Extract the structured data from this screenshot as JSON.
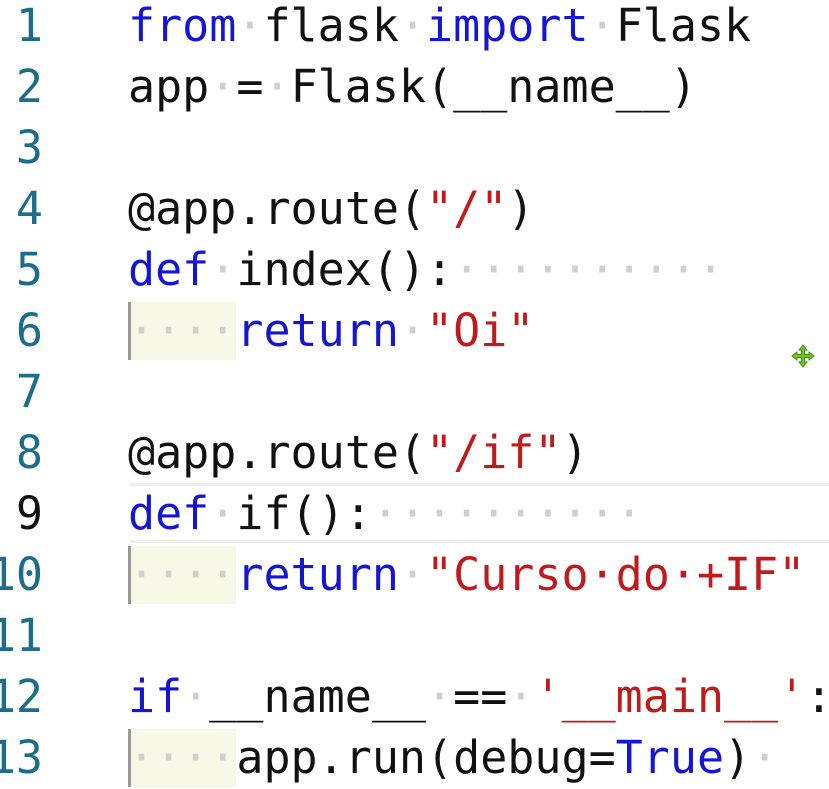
{
  "editor": {
    "language": "python",
    "colors": {
      "keyword": "#1515d8",
      "string": "#c21a1a",
      "line_number": "#1e6c8c",
      "whitespace_marker": "#cfcfcf"
    },
    "lines": [
      {
        "number": "1",
        "segments": [
          {
            "t": "kw",
            "v": "from"
          },
          {
            "t": "ws",
            "v": "·"
          },
          {
            "t": "tx",
            "v": "flask"
          },
          {
            "t": "ws",
            "v": "·"
          },
          {
            "t": "kw",
            "v": "import"
          },
          {
            "t": "ws",
            "v": "·"
          },
          {
            "t": "tx",
            "v": "Flask"
          }
        ]
      },
      {
        "number": "2",
        "segments": [
          {
            "t": "tx",
            "v": "app"
          },
          {
            "t": "ws",
            "v": "·"
          },
          {
            "t": "tx",
            "v": "="
          },
          {
            "t": "ws",
            "v": "·"
          },
          {
            "t": "tx",
            "v": "Flask(__name__)"
          }
        ]
      },
      {
        "number": "3",
        "segments": []
      },
      {
        "number": "4",
        "segments": [
          {
            "t": "tx",
            "v": "@app.route("
          },
          {
            "t": "str",
            "v": "\"/\""
          },
          {
            "t": "tx",
            "v": ")"
          }
        ]
      },
      {
        "number": "5",
        "segments": [
          {
            "t": "kw",
            "v": "def"
          },
          {
            "t": "ws",
            "v": "·"
          },
          {
            "t": "tx",
            "v": "index():"
          },
          {
            "t": "ws",
            "v": "··········"
          }
        ]
      },
      {
        "number": "6",
        "segments": [
          {
            "t": "ws",
            "v": "····"
          },
          {
            "t": "kw",
            "v": "return"
          },
          {
            "t": "ws",
            "v": "·"
          },
          {
            "t": "str",
            "v": "\"Oi\""
          }
        ]
      },
      {
        "number": "7",
        "segments": []
      },
      {
        "number": "8",
        "segments": [
          {
            "t": "tx",
            "v": "@app.route("
          },
          {
            "t": "str",
            "v": "\"/if\""
          },
          {
            "t": "tx",
            "v": ")"
          }
        ]
      },
      {
        "number": "9",
        "segments": [
          {
            "t": "kw",
            "v": "def"
          },
          {
            "t": "ws",
            "v": "·"
          },
          {
            "t": "tx",
            "v": "if():"
          },
          {
            "t": "ws",
            "v": "··········"
          }
        ]
      },
      {
        "number": "10",
        "segments": [
          {
            "t": "ws",
            "v": "····"
          },
          {
            "t": "kw",
            "v": "return"
          },
          {
            "t": "ws",
            "v": "·"
          },
          {
            "t": "str",
            "v": "\"Curso·do·+IF\""
          }
        ]
      },
      {
        "number": "11",
        "segments": []
      },
      {
        "number": "12",
        "segments": [
          {
            "t": "kw",
            "v": "if"
          },
          {
            "t": "ws",
            "v": "·"
          },
          {
            "t": "tx",
            "v": "__name__"
          },
          {
            "t": "ws",
            "v": "·"
          },
          {
            "t": "tx",
            "v": "=="
          },
          {
            "t": "ws",
            "v": "·"
          },
          {
            "t": "str",
            "v": "'__main__'"
          },
          {
            "t": "tx",
            "v": ":"
          }
        ]
      },
      {
        "number": "13",
        "segments": [
          {
            "t": "ws",
            "v": "····"
          },
          {
            "t": "tx",
            "v": "app.run(debug="
          },
          {
            "t": "kw",
            "v": "True"
          },
          {
            "t": "tx",
            "v": ")"
          },
          {
            "t": "ws",
            "v": "·"
          }
        ]
      }
    ],
    "current_line": "9",
    "cursor_icon": "move-cursor-icon"
  }
}
